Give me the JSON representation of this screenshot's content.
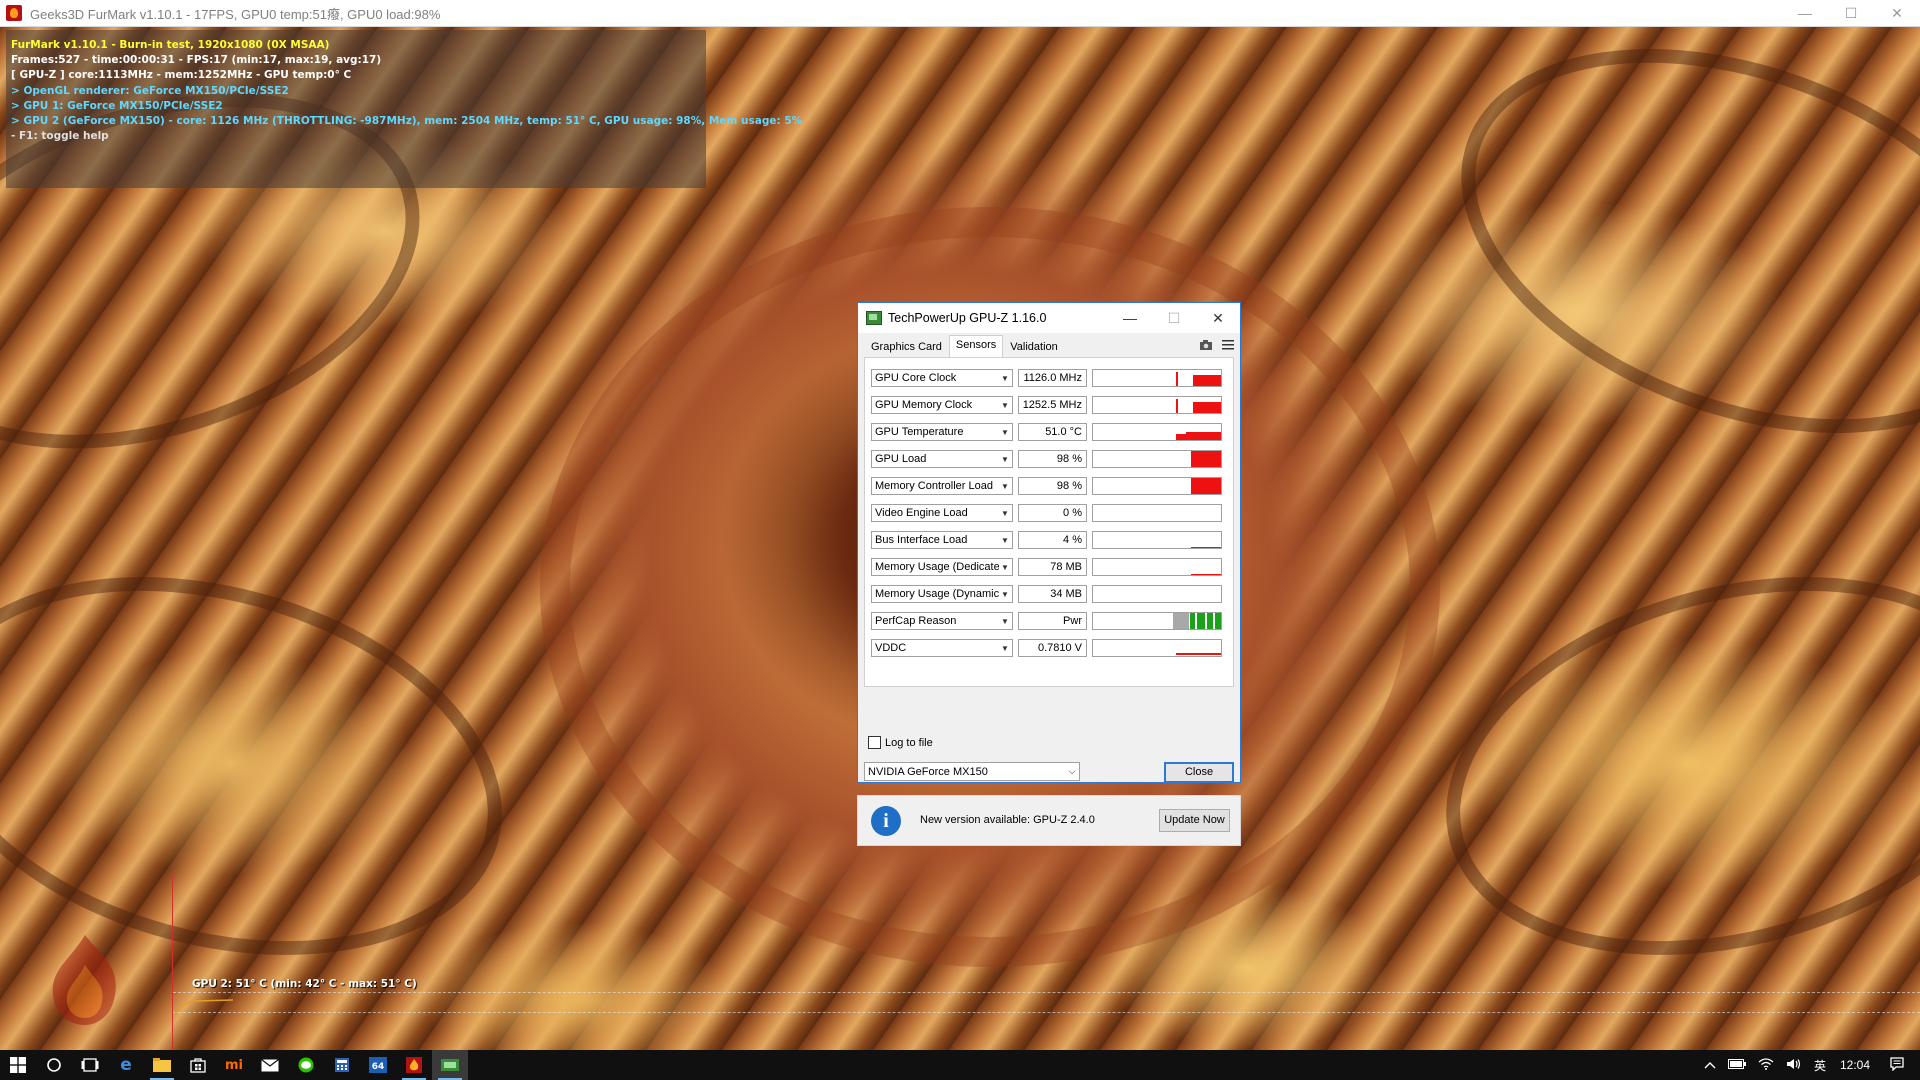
{
  "furmark_window": {
    "title": "Geeks3D FurMark v1.10.1 - 17FPS, GPU0 temp:51癈, GPU0 load:98%",
    "controls": {
      "minimize": "—",
      "maximize": "☐",
      "close": "✕"
    }
  },
  "overlay": {
    "lines": [
      {
        "text": "FurMark v1.10.1 - Burn-in test, 1920x1080 (0X MSAA)",
        "color": "yellow"
      },
      {
        "text": "Frames:527 - time:00:00:31 - FPS:17 (min:17, max:19, avg:17)",
        "color": "white"
      },
      {
        "text": "[ GPU-Z ] core:1113MHz - mem:1252MHz - GPU temp:0° C",
        "color": "white"
      },
      {
        "text": "> OpenGL renderer: GeForce MX150/PCIe/SSE2",
        "color": "cyan"
      },
      {
        "text": "> GPU 1: GeForce MX150/PCIe/SSE2",
        "color": "cyan"
      },
      {
        "text": "> GPU 2 (GeForce MX150) - core: 1126 MHz (THROTTLING: -987MHz), mem: 2504 MHz, temp: 51° C, GPU usage: 98%, Mem usage: 5%",
        "color": "cyan"
      },
      {
        "text": "- F1: toggle help",
        "color": "grey"
      }
    ]
  },
  "temp_graph": {
    "label": "GPU 2: 51° C (min: 42° C - max: 51° C)",
    "line_color": "#e0a020"
  },
  "gpuz": {
    "title": "TechPowerUp GPU-Z 1.16.0",
    "controls": {
      "minimize": "—",
      "maximize": "☐",
      "close": "✕"
    },
    "tabs": [
      "Graphics Card",
      "Sensors",
      "Validation"
    ],
    "active_tab": "Sensors",
    "toolbar_icons": [
      "camera-icon",
      "menu-icon"
    ],
    "sensors": [
      {
        "name": "GPU Core Clock",
        "value": "1126.0 MHz",
        "level": 0.88,
        "graph": "spike-block"
      },
      {
        "name": "GPU Memory Clock",
        "value": "1252.5 MHz",
        "level": 0.88,
        "graph": "spike-block"
      },
      {
        "name": "GPU Temperature",
        "value": "51.0 °C",
        "level": 0.55,
        "graph": "low-block"
      },
      {
        "name": "GPU Load",
        "value": "98 %",
        "level": 0.98,
        "graph": "full-block"
      },
      {
        "name": "Memory Controller Load",
        "value": "98 %",
        "level": 0.98,
        "graph": "full-block"
      },
      {
        "name": "Video Engine Load",
        "value": "0 %",
        "level": 0.0,
        "graph": "none"
      },
      {
        "name": "Bus Interface Load",
        "value": "4 %",
        "level": 0.04,
        "graph": "line"
      },
      {
        "name": "Memory Usage (Dedicated)",
        "value": "78 MB",
        "level": 0.05,
        "graph": "line"
      },
      {
        "name": "Memory Usage (Dynamic)",
        "value": "34 MB",
        "level": 0.0,
        "graph": "none"
      },
      {
        "name": "PerfCap Reason",
        "value": "Pwr",
        "level": 1.0,
        "graph": "perfcap"
      },
      {
        "name": "VDDC",
        "value": "0.7810 V",
        "level": 0.12,
        "graph": "line-low"
      }
    ],
    "log_to_file": {
      "label": "Log to file",
      "checked": false
    },
    "gpu_select": "NVIDIA GeForce MX150",
    "close_label": "Close",
    "accent_color": "#2b79d6",
    "graph_color": "#ee1111"
  },
  "update_notice": {
    "text": "New version available: GPU-Z 2.4.0",
    "button": "Update Now",
    "icon": "info-icon"
  },
  "taskbar": {
    "icons": [
      "windows-start-icon",
      "cortana-icon",
      "task-view-icon",
      "edge-icon",
      "file-explorer-icon",
      "store-icon",
      "mi-icon",
      "mail-icon",
      "wechat-icon",
      "calculator-icon",
      "cpu-z-64-icon",
      "furmark-icon",
      "gpu-z-icon"
    ],
    "tray": {
      "ime": "英",
      "time": "12:04"
    }
  }
}
